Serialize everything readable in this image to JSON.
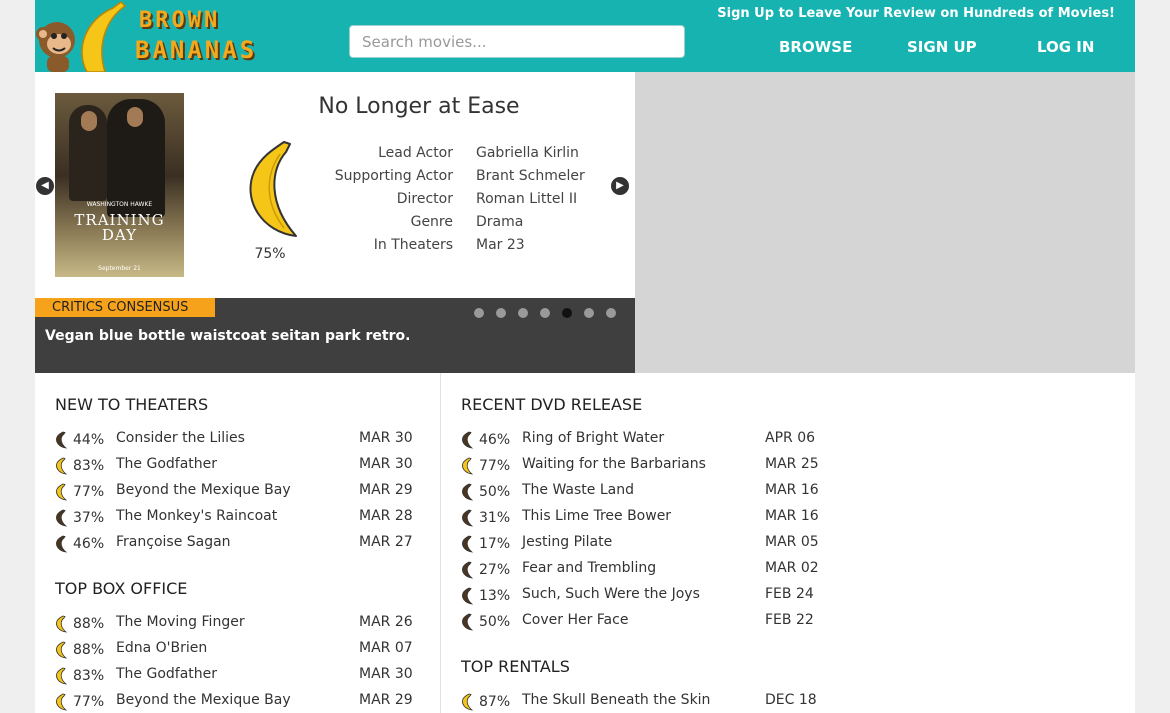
{
  "header": {
    "logo_line1": "BROWN",
    "logo_line2": "BANANAS",
    "search_placeholder": "Search movies...",
    "tagline": "Sign Up to Leave Your Review on Hundreds of Movies!",
    "nav": [
      "BROWSE",
      "SIGN UP",
      "LOG IN"
    ]
  },
  "featured": {
    "title": "No Longer at Ease",
    "score": "75%",
    "score_value": 75,
    "poster": {
      "names": "WASHINGTON   HAWKE",
      "title_line1": "TRAINING",
      "title_line2": "DAY",
      "date": "September 21"
    },
    "info": [
      {
        "label": "Lead Actor",
        "value": "Gabriella Kirlin"
      },
      {
        "label": "Supporting Actor",
        "value": "Brant Schmeler"
      },
      {
        "label": "Director",
        "value": "Roman Littel II"
      },
      {
        "label": "Genre",
        "value": "Drama"
      },
      {
        "label": "In Theaters",
        "value": "Mar 23"
      }
    ],
    "consensus_label": "CRITICS CONSENSUS",
    "consensus_text": "Vegan blue bottle waistcoat seitan park retro.",
    "slide_count": 7,
    "active_slide": 5
  },
  "new_to_theaters": {
    "title": "NEW TO THEATERS",
    "rows": [
      {
        "pct": "44%",
        "name": "Consider the Lilies",
        "date": "MAR 30",
        "fresh": false
      },
      {
        "pct": "83%",
        "name": "The Godfather",
        "date": "MAR 30",
        "fresh": true
      },
      {
        "pct": "77%",
        "name": "Beyond the Mexique Bay",
        "date": "MAR 29",
        "fresh": true
      },
      {
        "pct": "37%",
        "name": "The Monkey's Raincoat",
        "date": "MAR 28",
        "fresh": false
      },
      {
        "pct": "46%",
        "name": "Françoise Sagan",
        "date": "MAR 27",
        "fresh": false
      }
    ]
  },
  "top_box_office": {
    "title": "TOP BOX OFFICE",
    "rows": [
      {
        "pct": "88%",
        "name": "The Moving Finger",
        "date": "MAR 26",
        "fresh": true
      },
      {
        "pct": "88%",
        "name": "Edna O'Brien",
        "date": "MAR 07",
        "fresh": true
      },
      {
        "pct": "83%",
        "name": "The Godfather",
        "date": "MAR 30",
        "fresh": true
      },
      {
        "pct": "77%",
        "name": "Beyond the Mexique Bay",
        "date": "MAR 29",
        "fresh": true
      }
    ]
  },
  "recent_dvd": {
    "title": "RECENT DVD RELEASE",
    "rows": [
      {
        "pct": "46%",
        "name": "Ring of Bright Water",
        "date": "APR 06",
        "fresh": false
      },
      {
        "pct": "77%",
        "name": "Waiting for the Barbarians",
        "date": "MAR 25",
        "fresh": true
      },
      {
        "pct": "50%",
        "name": "The Waste Land",
        "date": "MAR 16",
        "fresh": false
      },
      {
        "pct": "31%",
        "name": "This Lime Tree Bower",
        "date": "MAR 16",
        "fresh": false
      },
      {
        "pct": "17%",
        "name": "Jesting Pilate",
        "date": "MAR 05",
        "fresh": false
      },
      {
        "pct": "27%",
        "name": "Fear and Trembling",
        "date": "MAR 02",
        "fresh": false
      },
      {
        "pct": "13%",
        "name": "Such, Such Were the Joys",
        "date": "FEB 24",
        "fresh": false
      },
      {
        "pct": "50%",
        "name": "Cover Her Face",
        "date": "FEB 22",
        "fresh": false
      }
    ]
  },
  "top_rentals": {
    "title": "TOP RENTALS",
    "rows": [
      {
        "pct": "87%",
        "name": "The Skull Beneath the Skin",
        "date": "DEC 18",
        "fresh": true
      }
    ]
  },
  "colors": {
    "header_bg": "#17b3b0",
    "accent_orange": "#f7a21b",
    "fresh_banana": "#f5c518",
    "rotten_banana": "#4a3520"
  }
}
